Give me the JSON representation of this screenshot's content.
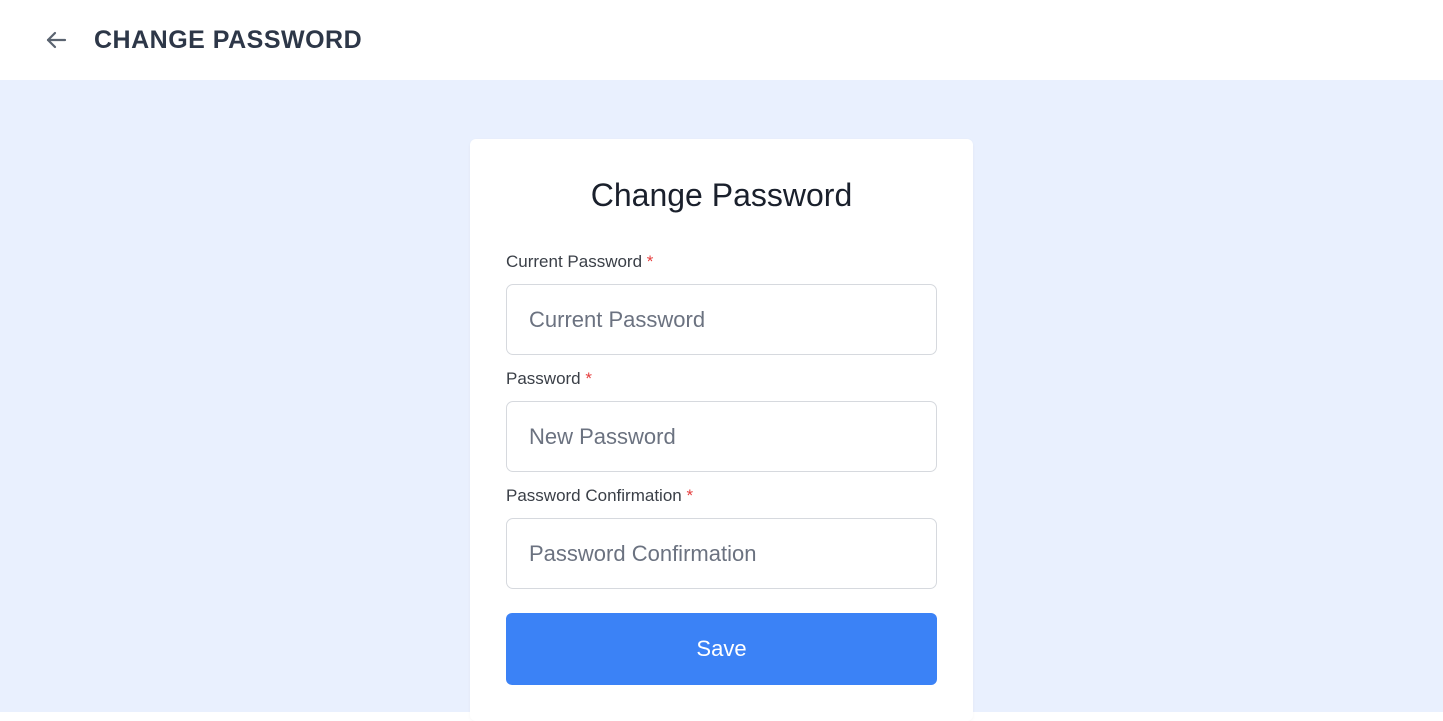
{
  "header": {
    "title": "CHANGE PASSWORD"
  },
  "card": {
    "title": "Change Password"
  },
  "form": {
    "current_password": {
      "label": "Current Password",
      "required": "*",
      "placeholder": "Current Password",
      "value": ""
    },
    "password": {
      "label": "Password",
      "required": "*",
      "placeholder": "New Password",
      "value": ""
    },
    "password_confirmation": {
      "label": "Password Confirmation",
      "required": "*",
      "placeholder": "Password Confirmation",
      "value": ""
    },
    "save_label": "Save"
  }
}
